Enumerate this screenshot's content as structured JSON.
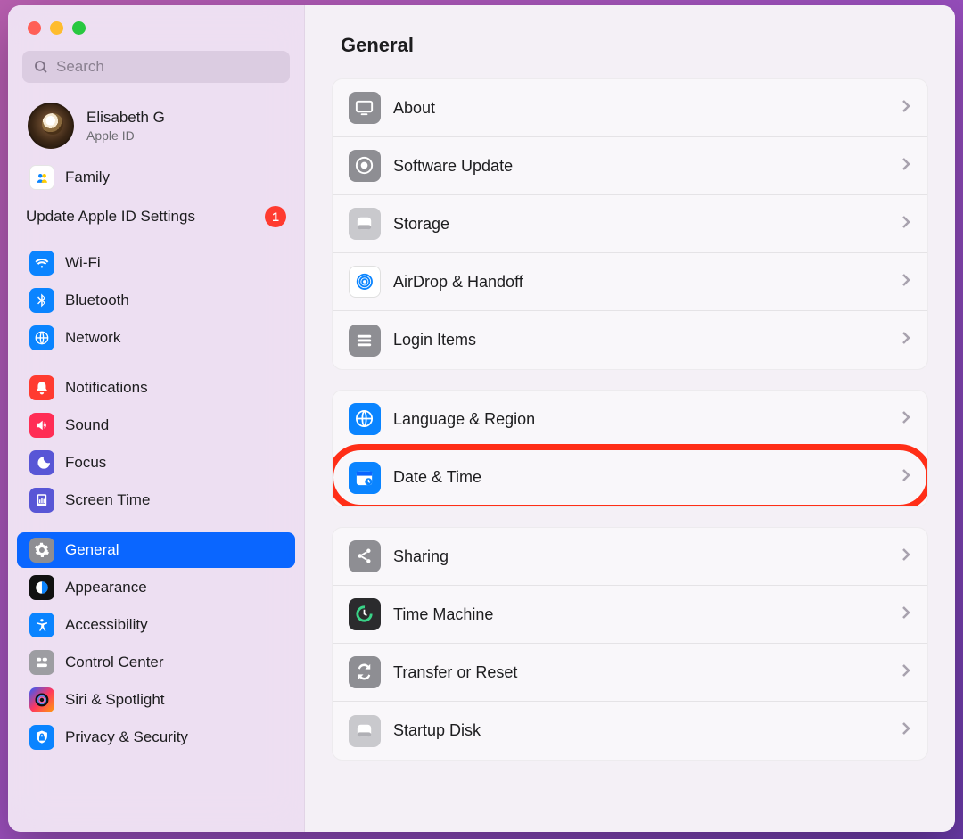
{
  "window": {
    "title": "General"
  },
  "search": {
    "placeholder": "Search"
  },
  "user": {
    "name": "Elisabeth G",
    "sub": "Apple ID"
  },
  "family": {
    "label": "Family"
  },
  "alert": {
    "label": "Update Apple ID Settings",
    "count": "1"
  },
  "sidebar": [
    {
      "key": "wifi",
      "label": "Wi-Fi",
      "color": "#0a84ff"
    },
    {
      "key": "bluetooth",
      "label": "Bluetooth",
      "color": "#0a84ff"
    },
    {
      "key": "network",
      "label": "Network",
      "color": "#0a84ff"
    },
    {
      "key": "notifications",
      "label": "Notifications",
      "color": "#ff3b30"
    },
    {
      "key": "sound",
      "label": "Sound",
      "color": "#ff2d55"
    },
    {
      "key": "focus",
      "label": "Focus",
      "color": "#5856d6"
    },
    {
      "key": "screentime",
      "label": "Screen Time",
      "color": "#5856d6"
    },
    {
      "key": "general",
      "label": "General",
      "color": "#8e8e93",
      "selected": true
    },
    {
      "key": "appearance",
      "label": "Appearance",
      "color": "#111111"
    },
    {
      "key": "accessibility",
      "label": "Accessibility",
      "color": "#0a84ff"
    },
    {
      "key": "controlcenter",
      "label": "Control Center",
      "color": "#9d9da2"
    },
    {
      "key": "siri",
      "label": "Siri & Spotlight",
      "color": "linear-gradient(135deg,#2e5cff,#ff375f,#ff9f0a)"
    },
    {
      "key": "privacy",
      "label": "Privacy & Security",
      "color": "#0a84ff"
    }
  ],
  "groups": [
    [
      {
        "key": "about",
        "label": "About",
        "iconColor": "#8e8e93"
      },
      {
        "key": "software-update",
        "label": "Software Update",
        "iconColor": "#8e8e93"
      },
      {
        "key": "storage",
        "label": "Storage",
        "iconColor": "#c9c9cd"
      },
      {
        "key": "airdrop",
        "label": "AirDrop & Handoff",
        "iconColor": "#ffffff"
      },
      {
        "key": "login-items",
        "label": "Login Items",
        "iconColor": "#8e8e93"
      }
    ],
    [
      {
        "key": "language-region",
        "label": "Language & Region",
        "iconColor": "#0a84ff"
      },
      {
        "key": "date-time",
        "label": "Date & Time",
        "iconColor": "#0a84ff",
        "highlight": true
      }
    ],
    [
      {
        "key": "sharing",
        "label": "Sharing",
        "iconColor": "#8e8e93"
      },
      {
        "key": "time-machine",
        "label": "Time Machine",
        "iconColor": "#2b2b2d"
      },
      {
        "key": "transfer-reset",
        "label": "Transfer or Reset",
        "iconColor": "#8e8e93"
      },
      {
        "key": "startup-disk",
        "label": "Startup Disk",
        "iconColor": "#c9c9cd"
      }
    ]
  ]
}
